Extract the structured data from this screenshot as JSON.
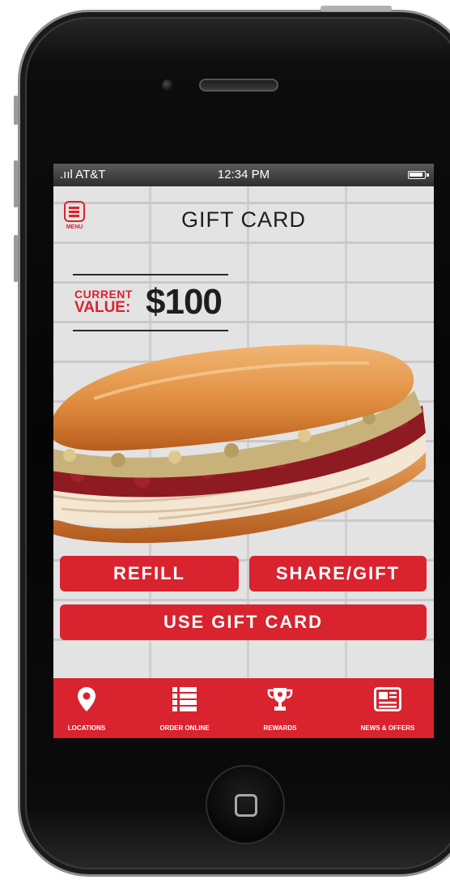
{
  "status_bar": {
    "carrier": ".ııl AT&T",
    "time": "12:34 PM"
  },
  "header": {
    "menu_label": "MENU",
    "title": "GIFT CARD"
  },
  "current_value": {
    "label_line1": "CURRENT",
    "label_line2": "VALUE:",
    "amount": "$100"
  },
  "actions": {
    "refill": "REFILL",
    "share_gift": "SHARE/GIFT",
    "use_gift_card": "USE GIFT CARD"
  },
  "tab_bar": {
    "items": [
      {
        "label": "LOCATIONS",
        "icon": "location-pin-icon"
      },
      {
        "label": "ORDER ONLINE",
        "icon": "list-icon"
      },
      {
        "label": "REWARDS",
        "icon": "trophy-icon"
      },
      {
        "label": "NEWS & OFFERS",
        "icon": "newspaper-icon"
      }
    ]
  },
  "colors": {
    "brand_red": "#d9232e",
    "title_dark": "#1e1e1e",
    "wall_light": "#e3e3e3"
  }
}
